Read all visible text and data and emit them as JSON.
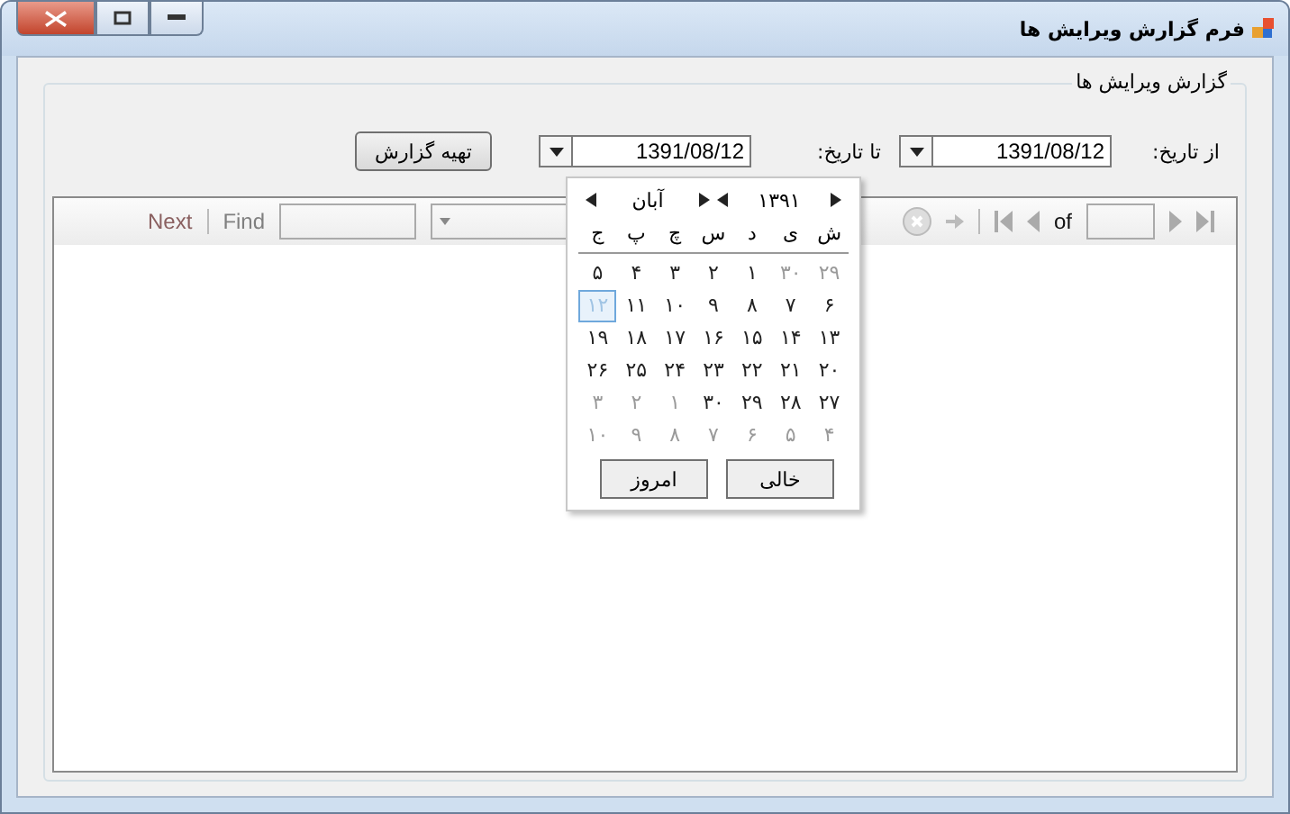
{
  "window": {
    "title": "فرم گزارش ویرایش ها"
  },
  "group": {
    "title": "گزارش ویرایش ها"
  },
  "filters": [
    {
      "label": "از تاریخ:",
      "value": "1391/08/12"
    },
    {
      "label": "تا تاریخ:",
      "value": "1391/08/12"
    }
  ],
  "report_button": "تهیه گزارش",
  "toolbar": {
    "page_of": "of",
    "find": "Find",
    "next": "Next"
  },
  "calendar": {
    "month": "آبان",
    "year": "۱۳۹۱",
    "weekdays": [
      "ش",
      "ی",
      "د",
      "س",
      "چ",
      "پ",
      "ج"
    ],
    "weeks": [
      [
        {
          "text": "۲۹",
          "muted": true,
          "selected": false
        },
        {
          "text": "۳۰",
          "muted": true,
          "selected": false
        },
        {
          "text": "۱",
          "muted": false,
          "selected": false
        },
        {
          "text": "۲",
          "muted": false,
          "selected": false
        },
        {
          "text": "۳",
          "muted": false,
          "selected": false
        },
        {
          "text": "۴",
          "muted": false,
          "selected": false
        },
        {
          "text": "۵",
          "muted": false,
          "selected": false
        }
      ],
      [
        {
          "text": "۶",
          "muted": false,
          "selected": false
        },
        {
          "text": "۷",
          "muted": false,
          "selected": false
        },
        {
          "text": "۸",
          "muted": false,
          "selected": false
        },
        {
          "text": "۹",
          "muted": false,
          "selected": false
        },
        {
          "text": "۱۰",
          "muted": false,
          "selected": false
        },
        {
          "text": "۱۱",
          "muted": false,
          "selected": false
        },
        {
          "text": "۱۲",
          "muted": false,
          "selected": true
        }
      ],
      [
        {
          "text": "۱۳",
          "muted": false,
          "selected": false
        },
        {
          "text": "۱۴",
          "muted": false,
          "selected": false
        },
        {
          "text": "۱۵",
          "muted": false,
          "selected": false
        },
        {
          "text": "۱۶",
          "muted": false,
          "selected": false
        },
        {
          "text": "۱۷",
          "muted": false,
          "selected": false
        },
        {
          "text": "۱۸",
          "muted": false,
          "selected": false
        },
        {
          "text": "۱۹",
          "muted": false,
          "selected": false
        }
      ],
      [
        {
          "text": "۲۰",
          "muted": false,
          "selected": false
        },
        {
          "text": "۲۱",
          "muted": false,
          "selected": false
        },
        {
          "text": "۲۲",
          "muted": false,
          "selected": false
        },
        {
          "text": "۲۳",
          "muted": false,
          "selected": false
        },
        {
          "text": "۲۴",
          "muted": false,
          "selected": false
        },
        {
          "text": "۲۵",
          "muted": false,
          "selected": false
        },
        {
          "text": "۲۶",
          "muted": false,
          "selected": false
        }
      ],
      [
        {
          "text": "۲۷",
          "muted": false,
          "selected": false
        },
        {
          "text": "۲۸",
          "muted": false,
          "selected": false
        },
        {
          "text": "۲۹",
          "muted": false,
          "selected": false
        },
        {
          "text": "۳۰",
          "muted": false,
          "selected": false
        },
        {
          "text": "۱",
          "muted": true,
          "selected": false
        },
        {
          "text": "۲",
          "muted": true,
          "selected": false
        },
        {
          "text": "۳",
          "muted": true,
          "selected": false
        }
      ],
      [
        {
          "text": "۴",
          "muted": true,
          "selected": false
        },
        {
          "text": "۵",
          "muted": true,
          "selected": false
        },
        {
          "text": "۶",
          "muted": true,
          "selected": false
        },
        {
          "text": "۷",
          "muted": true,
          "selected": false
        },
        {
          "text": "۸",
          "muted": true,
          "selected": false
        },
        {
          "text": "۹",
          "muted": true,
          "selected": false
        },
        {
          "text": "۱۰",
          "muted": true,
          "selected": false
        }
      ]
    ],
    "buttons": [
      "خالی",
      "امروز"
    ]
  }
}
